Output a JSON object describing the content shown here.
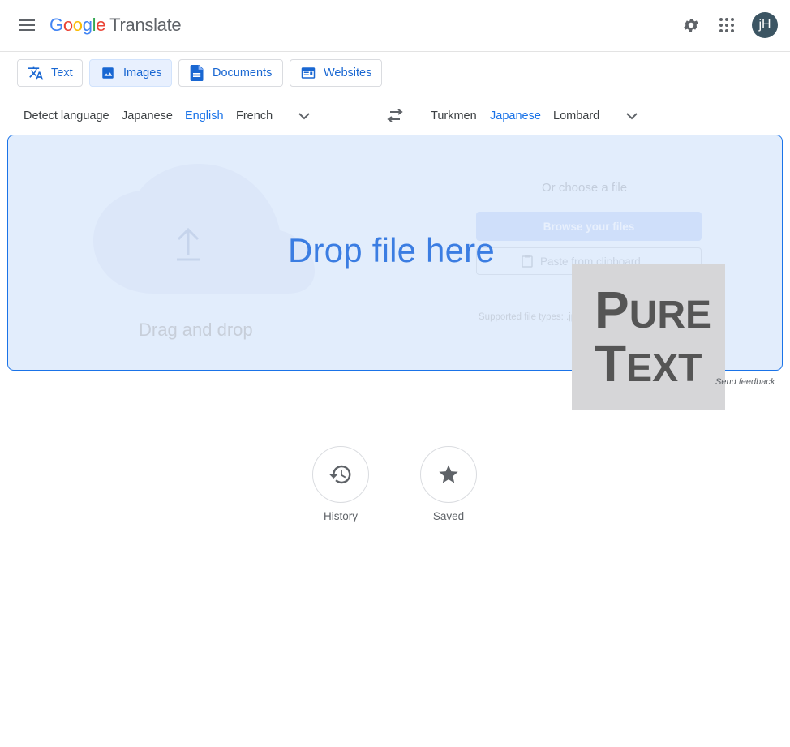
{
  "header": {
    "logo_letters": [
      "G",
      "o",
      "o",
      "g",
      "l",
      "e"
    ],
    "product": "Translate",
    "avatar_initials": "jH",
    "icons": [
      "menu-icon",
      "settings-icon",
      "apps-grid-icon"
    ]
  },
  "tabs": [
    {
      "label": "Text",
      "icon": "translate-icon",
      "active": false
    },
    {
      "label": "Images",
      "icon": "image-icon",
      "active": true
    },
    {
      "label": "Documents",
      "icon": "document-icon",
      "active": false
    },
    {
      "label": "Websites",
      "icon": "website-icon",
      "active": false
    }
  ],
  "source_languages": [
    "Detect language",
    "Japanese",
    "English",
    "French"
  ],
  "source_selected": "English",
  "target_languages": [
    "Turkmen",
    "Japanese",
    "Lombard"
  ],
  "target_selected": "Japanese",
  "dropzone": {
    "drag_and_drop": "Drag and drop",
    "or_choose": "Or choose a file",
    "browse": "Browse your files",
    "paste": "Paste from clipboard",
    "supported": "Supported file types: .jpg, .jpeg, .png",
    "drop_title": "Drop file here"
  },
  "watermark": {
    "line1_big": "P",
    "line1_small": "URE",
    "line2_big": "T",
    "line2_small": "EXT"
  },
  "feedback": "Send feedback",
  "bottom": {
    "history": "History",
    "saved": "Saved"
  },
  "colors": {
    "accent": "#1a73e8",
    "dropzone_bg": "#e2edfc",
    "avatar_bg": "#3c5563"
  }
}
